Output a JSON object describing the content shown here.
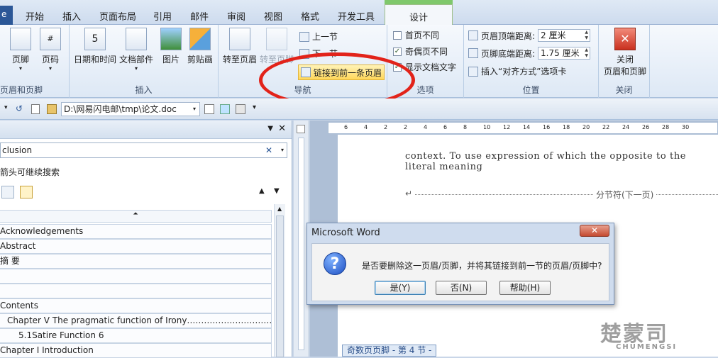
{
  "ribbon_tabs": {
    "file": "e",
    "items": [
      "开始",
      "插入",
      "页面布局",
      "引用",
      "邮件",
      "审阅",
      "视图",
      "格式",
      "开发工具"
    ],
    "context": "设计"
  },
  "groups": {
    "header_footer": {
      "label": "页眉和页脚",
      "header_btn": "页脚",
      "page_num_btn": "页码"
    },
    "insert": {
      "label": "插入",
      "datetime": "日期和时间",
      "docparts": "文档部件",
      "picture": "图片",
      "clipart": "剪贴画"
    },
    "navigation": {
      "label": "导航",
      "goto_header": "转至页眉",
      "goto_footer": "转至页脚",
      "prev": "上一节",
      "next": "下一节",
      "link_prev": "链接到前一条页眉"
    },
    "options": {
      "label": "选项",
      "diff_first": "首页不同",
      "diff_odd_even": "奇偶页不同",
      "show_doc_text": "显示文档文字",
      "diff_first_checked": false,
      "diff_odd_even_checked": true,
      "show_doc_text_checked": true
    },
    "position": {
      "label": "位置",
      "header_top_label": "页眉顶端距离:",
      "header_top_value": "2 厘米",
      "footer_bottom_label": "页脚底端距离:",
      "footer_bottom_value": "1.75 厘米",
      "insert_align": "插入“对齐方式”选项卡"
    },
    "close": {
      "label": "关闭",
      "close_btn_line1": "关闭",
      "close_btn_line2": "页眉和页脚"
    }
  },
  "quick_access": {
    "path": "D:\\网易闪电邮\\tmp\\论文.doc"
  },
  "nav_pane": {
    "search_value": "clusion",
    "hint": "箭头可继续搜索",
    "items": [
      "Acknowledgements",
      "Abstract",
      "摘    要",
      "",
      "",
      "Contents",
      "Chapter V The pragmatic function of Irony……………………………………",
      "5.1Satire Function 6",
      "Chapter I Introduction"
    ]
  },
  "ruler_ticks": [
    "6",
    "4",
    "2",
    "2",
    "4",
    "6",
    "8",
    "10",
    "12",
    "14",
    "16",
    "18",
    "20",
    "22",
    "24",
    "26",
    "28",
    "30"
  ],
  "document": {
    "line1": "context. To use expression of which the opposite to the literal meaning",
    "section_break": "分节符(下一页)",
    "footer_tag": "奇数页页脚 - 第 4 节 -"
  },
  "dialog": {
    "title": "Microsoft Word",
    "message": "是否要删除这一页眉/页脚，并将其链接到前一节的页眉/页脚中?",
    "yes": "是(Y)",
    "no": "否(N)",
    "help": "帮助(H)"
  },
  "watermark": {
    "cn": "楚蒙司",
    "en": "CHUMENGSI"
  },
  "colors": {
    "accent": "#2b5797",
    "context_tab": "#7fc86b",
    "highlight_ring": "#e2231a"
  }
}
